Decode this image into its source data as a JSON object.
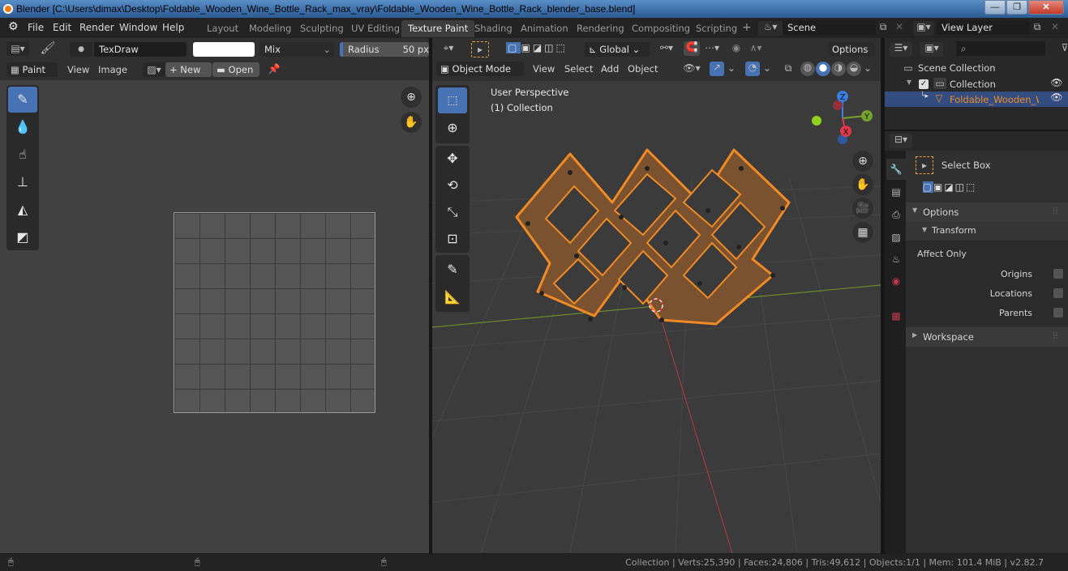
{
  "window": {
    "title": "Blender [C:\\Users\\dimax\\Desktop\\Foldable_Wooden_Wine_Bottle_Rack_max_vray\\Foldable_Wooden_Wine_Bottle_Rack_blender_base.blend]",
    "minimize": "—",
    "maximize": "❐",
    "close": "✕"
  },
  "menubar": {
    "items": [
      "File",
      "Edit",
      "Render",
      "Window",
      "Help"
    ]
  },
  "workspaces": {
    "tabs": [
      "Layout",
      "Modeling",
      "Sculpting",
      "UV Editing",
      "Texture Paint",
      "Shading",
      "Animation",
      "Rendering",
      "Compositing",
      "Scripting"
    ],
    "active": "Texture Paint",
    "add": "+"
  },
  "scene": {
    "name": "Scene"
  },
  "view_layer": {
    "name": "View Layer"
  },
  "image_editor": {
    "brush_name": "TexDraw",
    "color_hex": "#ffffff",
    "blend_mode": "Mix",
    "radius_label": "Radius",
    "radius_value": "50 px",
    "mode_label": "Paint",
    "menus": [
      "View",
      "Image"
    ],
    "new_label": "New",
    "open_label": "Open",
    "tools": [
      "draw",
      "soften",
      "smear",
      "clone",
      "fill",
      "mask"
    ],
    "active_tool": "draw"
  },
  "viewport": {
    "transform_orientation": "Global",
    "options_label": "Options",
    "mode": "Object Mode",
    "menus": [
      "View",
      "Select",
      "Add",
      "Object"
    ],
    "view_name": "User Perspective",
    "collection_label": "(1) Collection",
    "gizmo_axes": {
      "x": "X",
      "y": "Y",
      "z": "Z"
    },
    "axis_colors": {
      "x": "#e0384b",
      "y": "#76a12c",
      "z": "#3a7fe0"
    },
    "tools": [
      "select-box",
      "cursor",
      "move",
      "rotate",
      "scale",
      "transform",
      "annotate",
      "measure"
    ],
    "active_tool": "select-box",
    "selection_color": "#f08a24"
  },
  "outliner": {
    "scene_collection": "Scene Collection",
    "collection": "Collection",
    "object": "Foldable_Wooden_Wine_"
  },
  "properties": {
    "tool_name": "Select Box",
    "options_label": "Options",
    "transform_label": "Transform",
    "affect_only_label": "Affect Only",
    "checkboxes": [
      {
        "label": "Origins",
        "checked": false
      },
      {
        "label": "Locations",
        "checked": false
      },
      {
        "label": "Parents",
        "checked": false
      }
    ],
    "workspace_label": "Workspace"
  },
  "statusbar": {
    "stats": "Collection | Verts:25,390 | Faces:24,806 | Tris:49,612 | Objects:1/1 | Mem: 101.4 MiB | v2.82.7"
  }
}
